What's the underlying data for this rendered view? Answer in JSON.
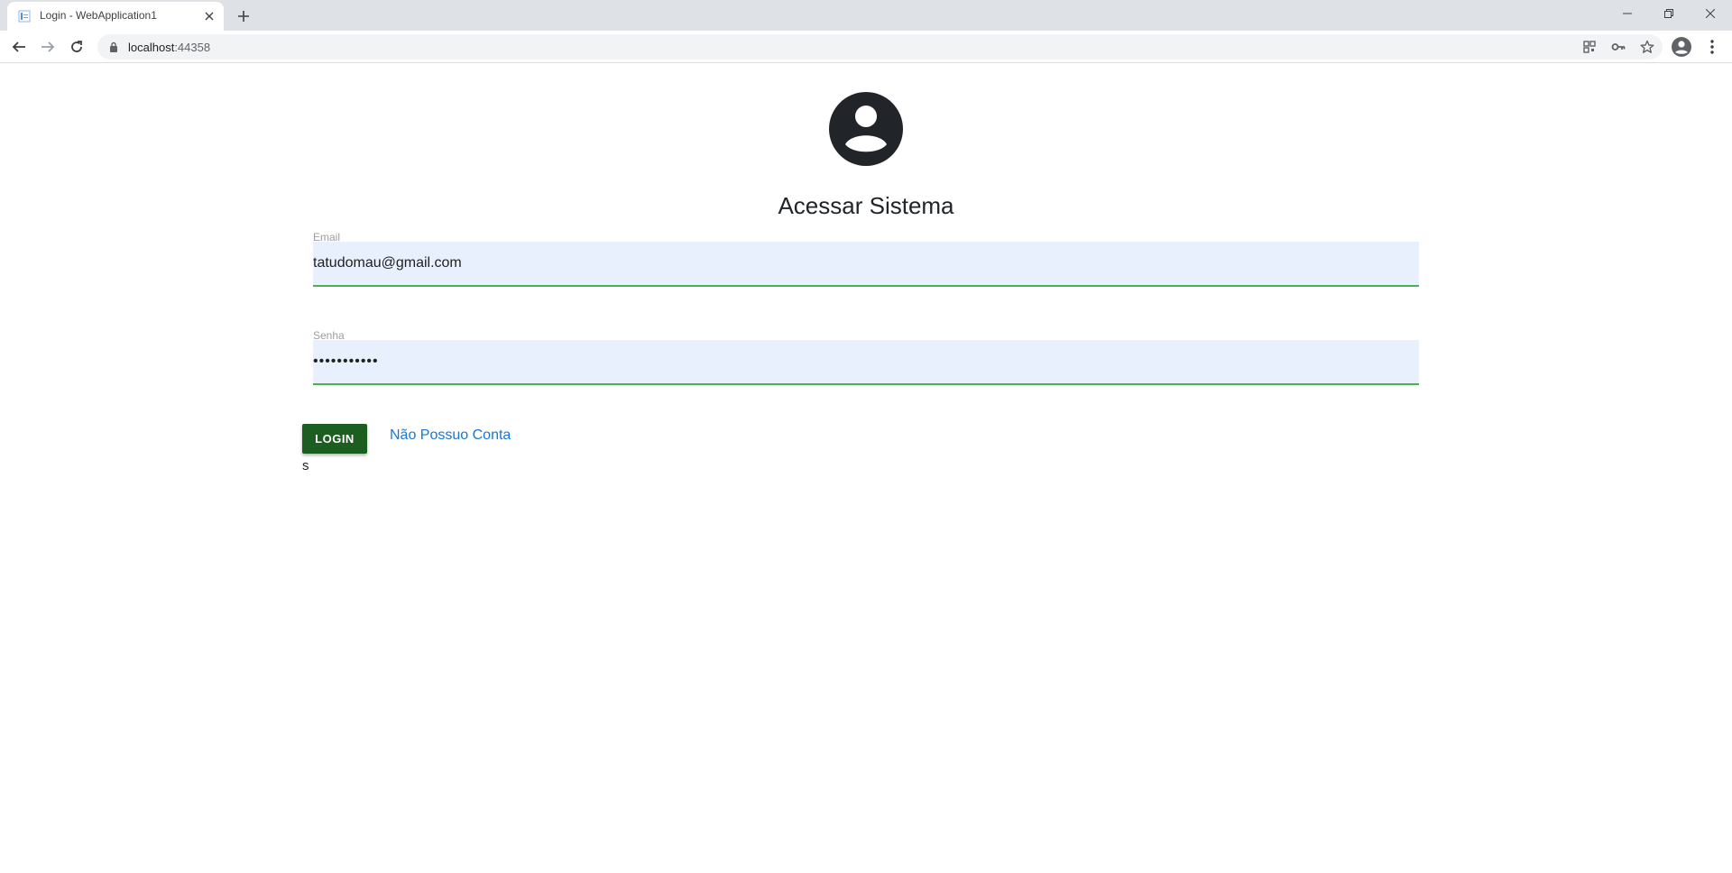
{
  "browser": {
    "tab_title": "Login - WebApplication1",
    "url_host": "localhost",
    "url_port": ":44358"
  },
  "page": {
    "title": "Acessar Sistema",
    "email": {
      "label": "Email",
      "value": "tatudomau@gmail.com"
    },
    "password": {
      "label": "Senha",
      "masked_value": "•••••••••••"
    },
    "login_button_label": "LOGIN",
    "no_account_link": "Não Possuo Conta",
    "stray_text": "s"
  },
  "colors": {
    "button_bg": "#1b5e20",
    "link": "#1976d2",
    "input_bg": "#e8f0fe",
    "input_underline": "#4caf50",
    "avatar": "#212529"
  }
}
